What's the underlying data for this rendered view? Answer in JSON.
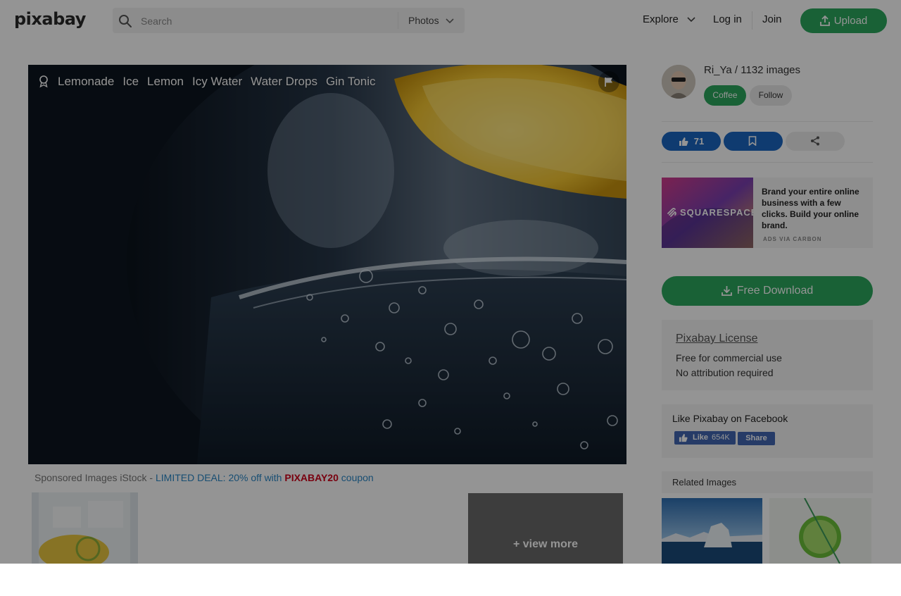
{
  "header": {
    "logo": "pixabay",
    "search_placeholder": "Search",
    "search_category": "Photos",
    "explore": "Explore",
    "login": "Log in",
    "join": "Join",
    "upload": "Upload"
  },
  "photo": {
    "tags": [
      "Lemonade",
      "Ice",
      "Lemon",
      "Icy Water",
      "Water Drops",
      "Gin Tonic"
    ]
  },
  "sponsored": {
    "prefix": "Sponsored Images iStock - ",
    "deal": "LIMITED DEAL: 20% off with ",
    "code": "PIXABAY20",
    "suffix": " coupon",
    "view_more": "+ view more"
  },
  "sidebar": {
    "author": "Ri_Ya / 1132 images",
    "coffee": "Coffee",
    "follow": "Follow",
    "likes": "71",
    "ad": {
      "image_text": "SQUARESPACE",
      "text": "Brand your entire online business with a few clicks. Build your online brand.",
      "via": "ADS VIA CARBON"
    },
    "download": "Free Download",
    "license": {
      "title": "Pixabay License",
      "line1": "Free for commercial use",
      "line2": "No attribution required"
    },
    "facebook": {
      "title": "Like Pixabay on Facebook",
      "like": "Like",
      "count": "654K",
      "share": "Share"
    },
    "related_title": "Related Images"
  },
  "colors": {
    "accent_green": "#2ba85d",
    "like_blue": "#1a66c2",
    "deal_blue": "#2a87c6",
    "code_red": "#d0021b",
    "facebook_blue": "#4267b2"
  }
}
